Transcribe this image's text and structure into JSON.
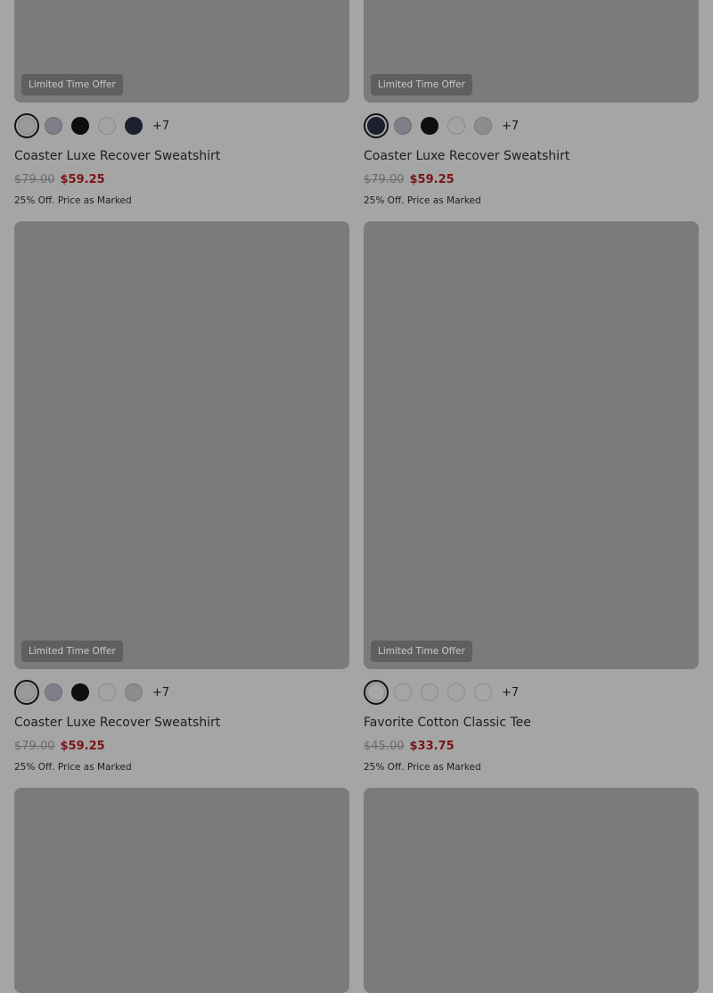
{
  "colors": {
    "page_bg": "#a5a5a5",
    "image_placeholder": "#7a7b7d",
    "badge_bg": "#5e5f61",
    "sale_price": "#7a1417"
  },
  "products": [
    {
      "badge": "Limited Time Offer",
      "swatches": [
        "#9a9a9a",
        "#7f7f8a",
        "#0e0e10",
        "#a3a3a3",
        "#1c2130"
      ],
      "selected_index": 0,
      "more_colors": "+7",
      "name": "Coaster Luxe Recover Sweatshirt",
      "original_price": "$79.00",
      "sale_price": "$59.25",
      "promo": "25% Off. Price as Marked"
    },
    {
      "badge": "Limited Time Offer",
      "swatches": [
        "#1c2130",
        "#7f7f8a",
        "#0e0e10",
        "#a3a3a3",
        "#8d8d8d"
      ],
      "selected_index": 0,
      "more_colors": "+7",
      "name": "Coaster Luxe Recover Sweatshirt",
      "original_price": "$79.00",
      "sale_price": "$59.25",
      "promo": "25% Off. Price as Marked"
    },
    {
      "badge": "Limited Time Offer",
      "swatches": [
        "#9a9a9a",
        "#7f7f8a",
        "#0e0e10",
        "#a3a3a3",
        "#8d8d8d"
      ],
      "selected_index": 0,
      "more_colors": "+7",
      "name": "Coaster Luxe Recover Sweatshirt",
      "original_price": "$79.00",
      "sale_price": "$59.25",
      "promo": "25% Off. Price as Marked"
    },
    {
      "badge": "Limited Time Offer",
      "swatches": [
        "#a6a6a6",
        "#a5a5a5",
        "#a4a4a4",
        "#a5a5a5",
        "#a6a6a6"
      ],
      "selected_index": 0,
      "more_colors": "+7",
      "name": "Favorite Cotton Classic Tee",
      "original_price": "$45.00",
      "sale_price": "$33.75",
      "promo": "25% Off. Price as Marked"
    }
  ]
}
